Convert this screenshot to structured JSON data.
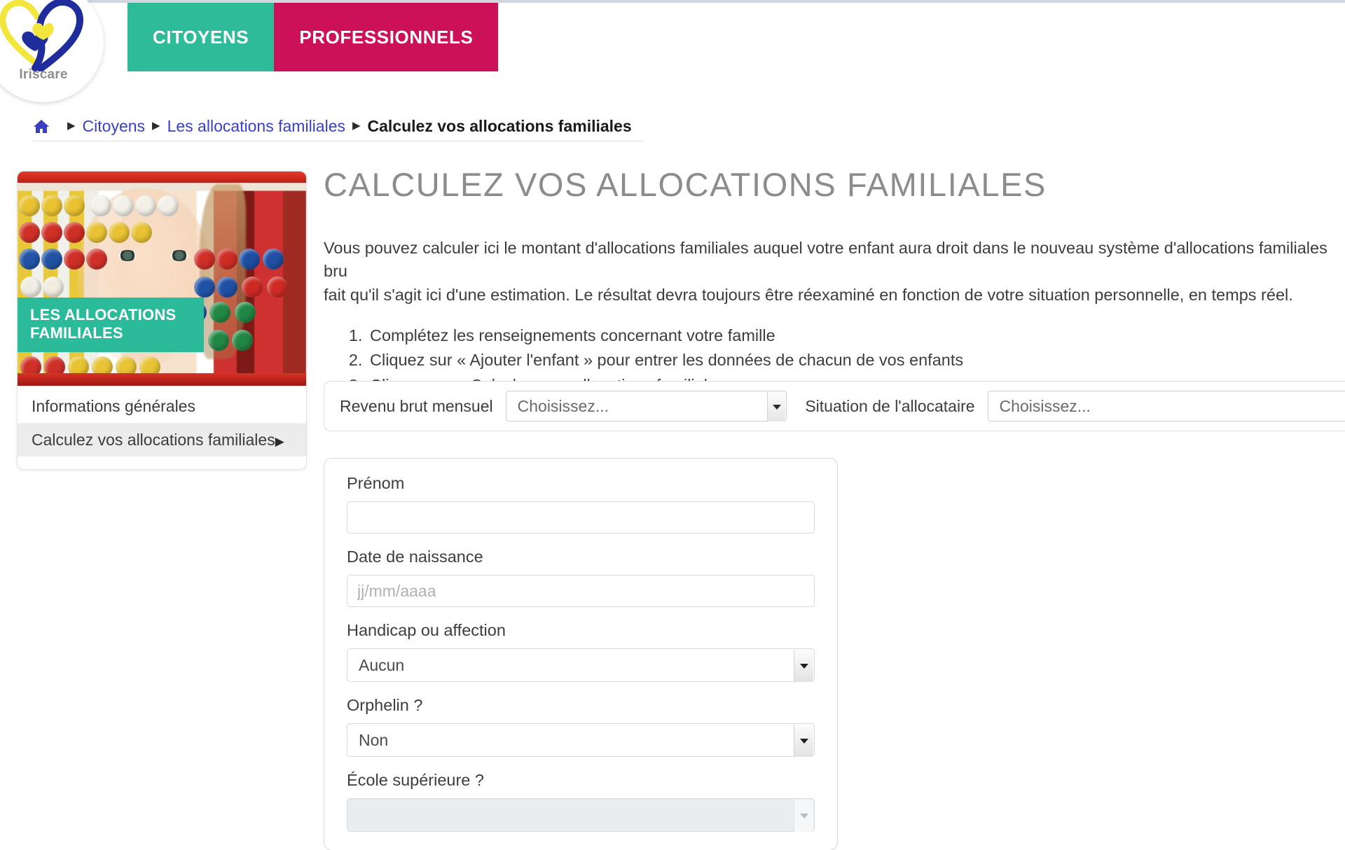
{
  "site": {
    "logo_caption": "Iriscare",
    "logo_icon": "heart-logo-icon"
  },
  "header": {
    "tabs": [
      {
        "label": "CITOYENS",
        "color": "#2dbb9a",
        "active": true
      },
      {
        "label": "PROFESSIONNELS",
        "color": "#cc1159",
        "active": false
      }
    ]
  },
  "breadcrumb": {
    "home_icon": "home-icon",
    "separator": "▶",
    "items": [
      {
        "label": "Citoyens",
        "current": false
      },
      {
        "label": "Les allocations familiales",
        "current": false
      },
      {
        "label": "Calculez vos allocations familiales",
        "current": true
      }
    ]
  },
  "sidebar": {
    "banner_title": "LES ALLOCATIONS FAMILIALES",
    "image_alt": "photo-enfant-boulier",
    "links": [
      {
        "label": "Informations générales",
        "active": false,
        "caret": ""
      },
      {
        "label": "Calculez vos allocations familiales",
        "active": true,
        "caret": "▶"
      }
    ]
  },
  "main": {
    "title": "CALCULEZ VOS ALLOCATIONS FAMILIALES",
    "intro": "Vous pouvez calculer ici le montant d'allocations familiales auquel votre enfant aura droit dans le nouveau système d'allocations familiales bru\nfait qu'il s'agit ici d'une estimation. Le résultat devra toujours être réexaminé en fonction de votre situation personnelle, en temps réel.",
    "steps": [
      "Complétez les renseignements concernant votre famille",
      "Cliquez sur « Ajouter l'enfant » pour entrer les données de chacun de vos enfants",
      "Cliquez sur « Calculez mes allocations familiales »"
    ]
  },
  "top_row": {
    "revenu_label": "Revenu brut mensuel",
    "revenu_value": "Choisissez...",
    "situation_label": "Situation de l'allocataire",
    "situation_value": "Choisissez..."
  },
  "child_form": {
    "prenom_label": "Prénom",
    "prenom_value": "",
    "prenom_placeholder": "",
    "naissance_label": "Date de naissance",
    "naissance_value": "",
    "naissance_placeholder": "jj/mm/aaaa",
    "handicap_label": "Handicap ou affection",
    "handicap_value": "Aucun",
    "orphelin_label": "Orphelin ?",
    "orphelin_value": "Non",
    "ecole_label": "École supérieure ?",
    "ecole_value": "",
    "ecole_disabled": true
  },
  "colors": {
    "teal": "#2dbb9a",
    "magenta": "#cc1159",
    "link_blue": "#3a3fc4",
    "title_grey": "#8c8c8c",
    "body_grey": "#3d3d3d"
  }
}
